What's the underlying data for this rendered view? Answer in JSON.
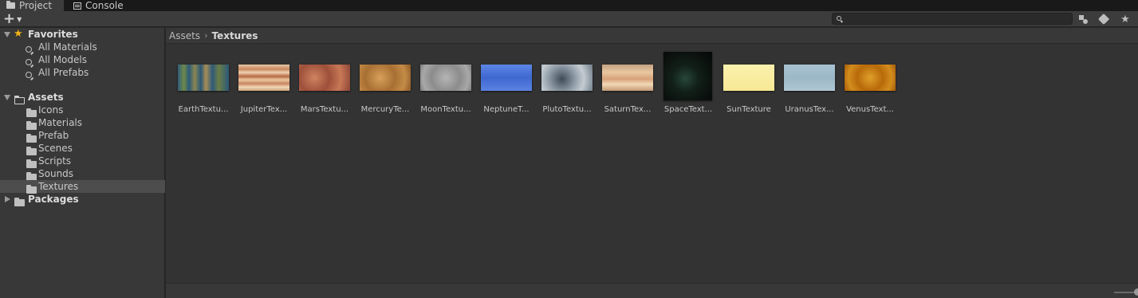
{
  "tabs": [
    {
      "label": "Project",
      "icon": "folder-icon"
    },
    {
      "label": "Console",
      "icon": "console-icon"
    }
  ],
  "toolbar": {
    "add_label": "+",
    "search": {
      "placeholder": "",
      "value": ""
    },
    "buttons": [
      "type-filter-icon",
      "label-filter-icon",
      "favorite-star-icon"
    ]
  },
  "sidebar": {
    "favorites": {
      "label": "Favorites",
      "items": [
        {
          "label": "All Materials"
        },
        {
          "label": "All Models"
        },
        {
          "label": "All Prefabs"
        }
      ]
    },
    "assets": {
      "label": "Assets",
      "items": [
        {
          "label": "Icons"
        },
        {
          "label": "Materials"
        },
        {
          "label": "Prefab"
        },
        {
          "label": "Scenes"
        },
        {
          "label": "Scripts"
        },
        {
          "label": "Sounds"
        },
        {
          "label": "Textures",
          "selected": true
        }
      ]
    },
    "packages": {
      "label": "Packages"
    }
  },
  "breadcrumb": {
    "root": "Assets",
    "current": "Textures"
  },
  "assets": [
    {
      "label": "EarthTextu...",
      "color": "#3d6f8c"
    },
    {
      "label": "JupiterTex...",
      "color": "#d9a077"
    },
    {
      "label": "MarsTextu...",
      "color": "#b5634a"
    },
    {
      "label": "MercuryTe...",
      "color": "#b7833f"
    },
    {
      "label": "MoonTextu...",
      "color": "#9a9a9a"
    },
    {
      "label": "NeptuneT...",
      "color": "#4a73d6"
    },
    {
      "label": "PlutoTextu...",
      "color": "#8b98a4"
    },
    {
      "label": "SaturnTex...",
      "color": "#d6aa80"
    },
    {
      "label": "SpaceText...",
      "color": "#101613"
    },
    {
      "label": "SunTexture",
      "color": "#f8eea2"
    },
    {
      "label": "UranusTex...",
      "color": "#a5c0cf"
    },
    {
      "label": "VenusText...",
      "color": "#c8780f"
    }
  ]
}
